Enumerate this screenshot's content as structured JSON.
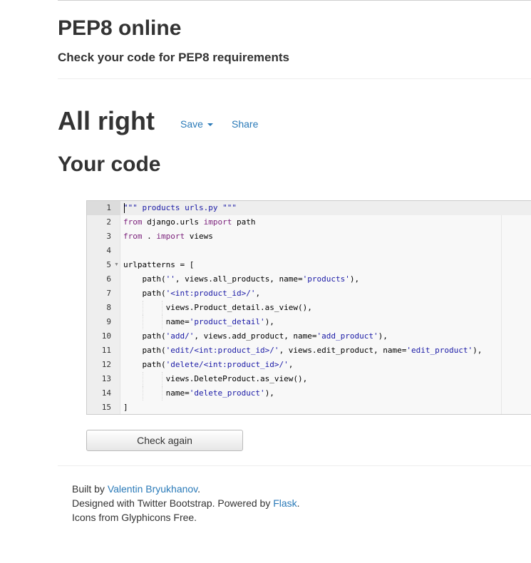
{
  "header": {
    "title": "PEP8 online",
    "subtitle": "Check your code for PEP8 requirements"
  },
  "result": {
    "status": "All right",
    "save_label": "Save",
    "share_label": "Share"
  },
  "code_section": {
    "title": "Your code"
  },
  "editor": {
    "active_line": 1,
    "lines": [
      {
        "n": "1",
        "tokens": [
          {
            "t": "str",
            "v": "\"\"\" products urls.py \"\"\""
          }
        ]
      },
      {
        "n": "2",
        "tokens": [
          {
            "t": "kw",
            "v": "from"
          },
          {
            "t": "plain",
            "v": " django.urls "
          },
          {
            "t": "kw",
            "v": "import"
          },
          {
            "t": "plain",
            "v": " path"
          }
        ]
      },
      {
        "n": "3",
        "tokens": [
          {
            "t": "kw",
            "v": "from"
          },
          {
            "t": "plain",
            "v": " . "
          },
          {
            "t": "kw",
            "v": "import"
          },
          {
            "t": "plain",
            "v": " views"
          }
        ]
      },
      {
        "n": "4",
        "tokens": []
      },
      {
        "n": "5",
        "fold": true,
        "tokens": [
          {
            "t": "plain",
            "v": "urlpatterns = ["
          }
        ]
      },
      {
        "n": "6",
        "tokens": [
          {
            "t": "plain",
            "v": "    path("
          },
          {
            "t": "str",
            "v": "''"
          },
          {
            "t": "plain",
            "v": ", views.all_products, name="
          },
          {
            "t": "str",
            "v": "'products'"
          },
          {
            "t": "plain",
            "v": "),"
          }
        ]
      },
      {
        "n": "7",
        "tokens": [
          {
            "t": "plain",
            "v": "    path("
          },
          {
            "t": "str",
            "v": "'<int:product_id>/'"
          },
          {
            "t": "plain",
            "v": ","
          }
        ]
      },
      {
        "n": "8",
        "guides": 2,
        "tokens": [
          {
            "t": "plain",
            "v": "         views.Product_detail.as_view(),"
          }
        ]
      },
      {
        "n": "9",
        "guides": 2,
        "tokens": [
          {
            "t": "plain",
            "v": "         name="
          },
          {
            "t": "str",
            "v": "'product_detail'"
          },
          {
            "t": "plain",
            "v": "),"
          }
        ]
      },
      {
        "n": "10",
        "tokens": [
          {
            "t": "plain",
            "v": "    path("
          },
          {
            "t": "str",
            "v": "'add/'"
          },
          {
            "t": "plain",
            "v": ", views.add_product, name="
          },
          {
            "t": "str",
            "v": "'add_product'"
          },
          {
            "t": "plain",
            "v": "),"
          }
        ]
      },
      {
        "n": "11",
        "tokens": [
          {
            "t": "plain",
            "v": "    path("
          },
          {
            "t": "str",
            "v": "'edit/<int:product_id>/'"
          },
          {
            "t": "plain",
            "v": ", views.edit_product, name="
          },
          {
            "t": "str",
            "v": "'edit_product'"
          },
          {
            "t": "plain",
            "v": "),"
          }
        ]
      },
      {
        "n": "12",
        "tokens": [
          {
            "t": "plain",
            "v": "    path("
          },
          {
            "t": "str",
            "v": "'delete/<int:product_id>/'"
          },
          {
            "t": "plain",
            "v": ","
          }
        ]
      },
      {
        "n": "13",
        "guides": 2,
        "tokens": [
          {
            "t": "plain",
            "v": "         views.DeleteProduct.as_view(),"
          }
        ]
      },
      {
        "n": "14",
        "guides": 2,
        "tokens": [
          {
            "t": "plain",
            "v": "         name="
          },
          {
            "t": "str",
            "v": "'delete_product'"
          },
          {
            "t": "plain",
            "v": "),"
          }
        ]
      },
      {
        "n": "15",
        "tokens": [
          {
            "t": "plain",
            "v": "]"
          }
        ]
      }
    ]
  },
  "actions": {
    "check_again_label": "Check again"
  },
  "footer": {
    "built_by_prefix": "Built by ",
    "author_link": "Valentin Bryukhanov",
    "built_by_suffix": ".",
    "designed_prefix": "Designed with Twitter Bootstrap. Powered by ",
    "flask_link": "Flask",
    "designed_suffix": ".",
    "icons_text": "Icons from Glyphicons Free."
  },
  "colors": {
    "link": "#2a7ab8",
    "keyword": "#7a1f7a",
    "string": "#1a1aa6"
  }
}
